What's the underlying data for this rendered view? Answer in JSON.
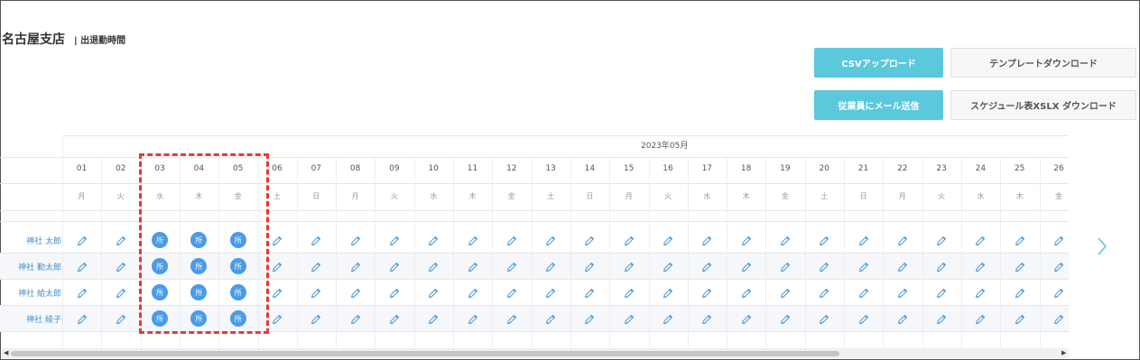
{
  "header": {
    "branch": "名古屋支店",
    "section": "| 出退勤時間"
  },
  "buttons": {
    "csv_upload": "CSVアップロード",
    "template_download": "テンプレートダウンロード",
    "email_staff": "従業員にメール送信",
    "schedule_download": "スケジュール表XSLX ダウンロード"
  },
  "calendar": {
    "month": "2023年05月",
    "days": [
      {
        "d": "01",
        "w": "月"
      },
      {
        "d": "02",
        "w": "火"
      },
      {
        "d": "03",
        "w": "水"
      },
      {
        "d": "04",
        "w": "木"
      },
      {
        "d": "05",
        "w": "金"
      },
      {
        "d": "06",
        "w": "土"
      },
      {
        "d": "07",
        "w": "日"
      },
      {
        "d": "08",
        "w": "月"
      },
      {
        "d": "09",
        "w": "火"
      },
      {
        "d": "10",
        "w": "水"
      },
      {
        "d": "11",
        "w": "木"
      },
      {
        "d": "12",
        "w": "金"
      },
      {
        "d": "13",
        "w": "土"
      },
      {
        "d": "14",
        "w": "日"
      },
      {
        "d": "15",
        "w": "月"
      },
      {
        "d": "16",
        "w": "火"
      },
      {
        "d": "17",
        "w": "水"
      },
      {
        "d": "18",
        "w": "木"
      },
      {
        "d": "19",
        "w": "金"
      },
      {
        "d": "20",
        "w": "土"
      },
      {
        "d": "21",
        "w": "日"
      },
      {
        "d": "22",
        "w": "月"
      },
      {
        "d": "23",
        "w": "火"
      },
      {
        "d": "24",
        "w": "水"
      },
      {
        "d": "25",
        "w": "木"
      },
      {
        "d": "26",
        "w": "金"
      }
    ],
    "employees": [
      "神社 太郎",
      "神社 勤太郎",
      "神社 給太郎",
      "神社 綾子"
    ],
    "badge_label": "所",
    "badge_day_indexes": [
      2,
      3,
      4
    ]
  },
  "colors": {
    "accent": "#5bc8dc",
    "badge": "#4a9be8",
    "highlight": "#e53935",
    "link": "#4a90c8"
  }
}
